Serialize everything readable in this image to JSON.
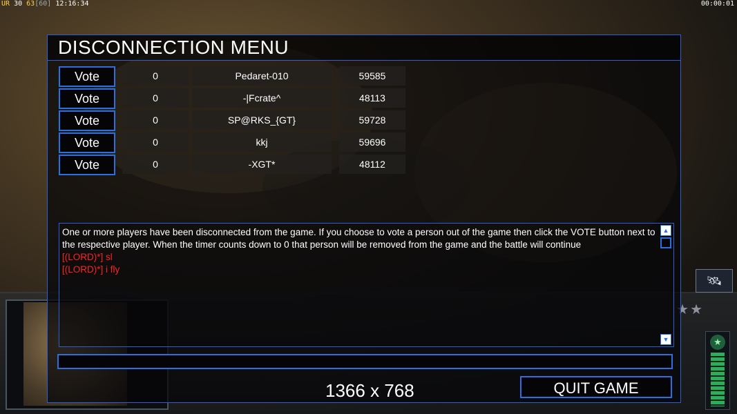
{
  "hud": {
    "ur_label": "UR",
    "val1": "30",
    "val2": "63",
    "val3": "[60]",
    "clock": "12:16:34",
    "timer": "00:00:01"
  },
  "menu": {
    "title": "DISCONNECTION MENU",
    "vote_label": "Vote",
    "players": [
      {
        "votes": "0",
        "name": "Pedaret-010",
        "id": "59585"
      },
      {
        "votes": "0",
        "name": "-|Fcrate^",
        "id": "48113"
      },
      {
        "votes": "0",
        "name": "SP@RKS_{GT}",
        "id": "59728"
      },
      {
        "votes": "0",
        "name": "kkj",
        "id": "59696"
      },
      {
        "votes": "0",
        "name": "-XGT*",
        "id": "48112"
      }
    ],
    "chat": {
      "system_message": "One or more players have been disconnected from the game. If you choose to vote a person out of the game then click the VOTE button next to the respective player. When the timer counts down to 0 that person will be removed from the game and the battle will continue",
      "line1": "[(LORD)*] sl",
      "line2": "[(LORD)*] i fly"
    },
    "resolution": "1366 x 768",
    "quit_label": "QUIT GAME"
  },
  "colors": {
    "accent": "#2b6fe0",
    "chat_red": "#ff2222"
  }
}
